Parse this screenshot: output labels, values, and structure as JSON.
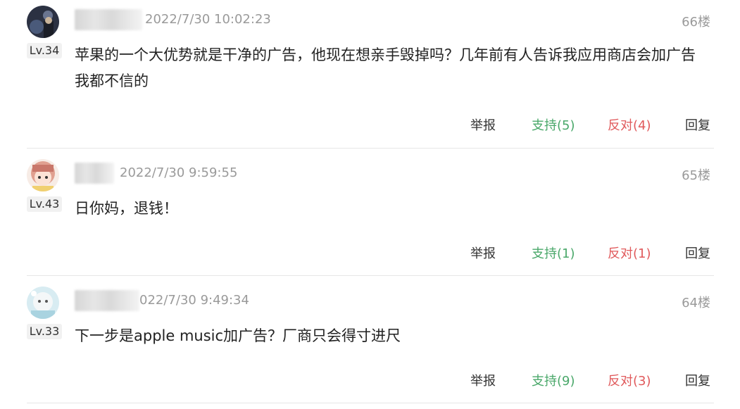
{
  "comments": [
    {
      "timestamp": "2022/7/30 10:02:23",
      "floor": "66楼",
      "level": "Lv.34",
      "content": "苹果的一个大优势就是干净的广告，他现在想亲手毁掉吗？几年前有人告诉我应用商店会加广告 我都不信的",
      "report": "举报",
      "support": "支持(5)",
      "oppose": "反对(4)",
      "reply": "回复"
    },
    {
      "timestamp": "2022/7/30 9:59:55",
      "floor": "65楼",
      "level": "Lv.43",
      "content": "日你妈，退钱！",
      "report": "举报",
      "support": "支持(1)",
      "oppose": "反对(1)",
      "reply": "回复"
    },
    {
      "timestamp": "022/7/30 9:49:34",
      "floor": "64楼",
      "level": "Lv.33",
      "content": "下一步是apple music加广告？厂商只会得寸进尺",
      "report": "举报",
      "support": "支持(9)",
      "oppose": "反对(3)",
      "reply": "回复"
    }
  ],
  "colors": {
    "support": "#4aa86a",
    "oppose": "#e0595b",
    "meta": "#9a9a9a"
  }
}
